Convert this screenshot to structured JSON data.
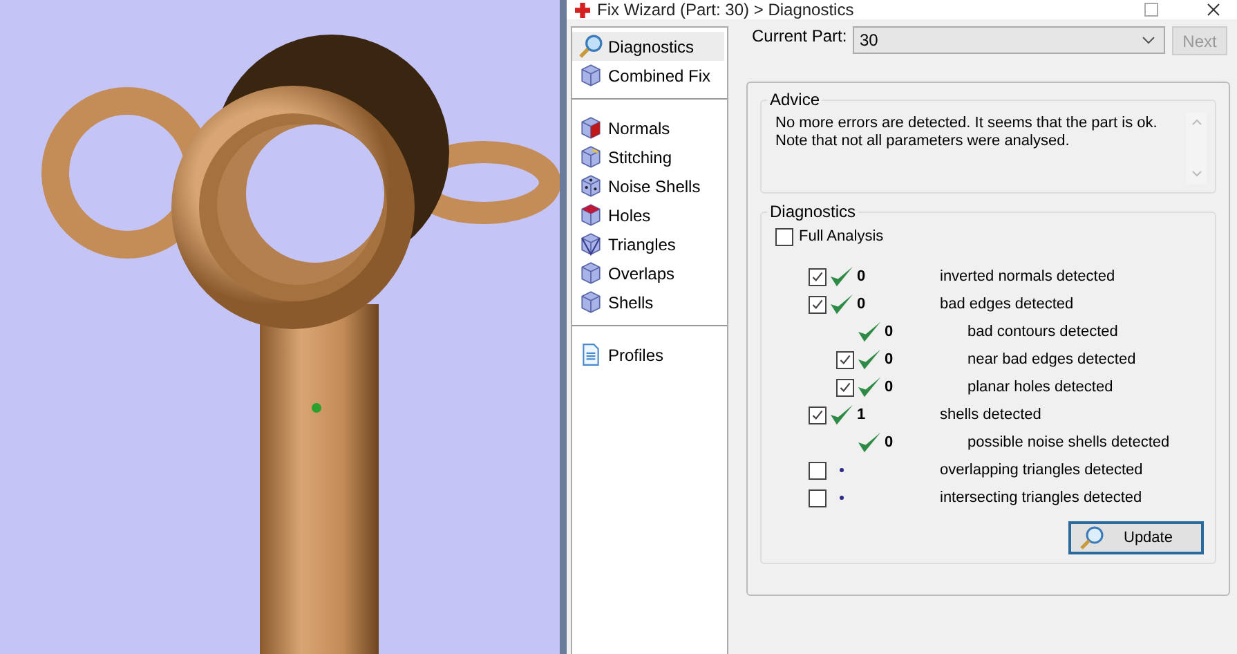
{
  "window": {
    "title": "Fix Wizard (Part: 30) > Diagnostics"
  },
  "sidebar": {
    "groups": [
      {
        "items": [
          {
            "label": "Diagnostics",
            "selected": true
          },
          {
            "label": "Combined Fix",
            "selected": false
          }
        ]
      },
      {
        "items": [
          {
            "label": "Normals",
            "selected": false
          },
          {
            "label": "Stitching",
            "selected": false
          },
          {
            "label": "Noise Shells",
            "selected": false
          },
          {
            "label": "Holes",
            "selected": false
          },
          {
            "label": "Triangles",
            "selected": false
          },
          {
            "label": "Overlaps",
            "selected": false
          },
          {
            "label": "Shells",
            "selected": false
          }
        ]
      },
      {
        "items": [
          {
            "label": "Profiles",
            "selected": false
          }
        ]
      }
    ]
  },
  "current_part": {
    "label": "Current Part:",
    "value": "30"
  },
  "next_button": {
    "label": "Next",
    "disabled": true
  },
  "advice": {
    "title": "Advice",
    "text": "No more errors are detected. It seems that the part is ok.\nNote that not all parameters were analysed."
  },
  "diagnostics": {
    "title": "Diagnostics",
    "full_analysis": {
      "label": "Full Analysis",
      "checked": false
    },
    "rows": [
      {
        "checked": true,
        "kind": "check",
        "count": "0",
        "label": "inverted normals detected"
      },
      {
        "checked": true,
        "kind": "check",
        "count": "0",
        "label": "bad edges detected",
        "children": [
          {
            "kind": "check",
            "count": "0",
            "label": "bad contours detected"
          },
          {
            "checked": true,
            "kind": "check",
            "count": "0",
            "label": "near bad edges detected"
          },
          {
            "checked": true,
            "kind": "check",
            "count": "0",
            "label": "planar holes detected"
          }
        ]
      },
      {
        "checked": true,
        "kind": "check",
        "count": "1",
        "label": "shells detected",
        "children": [
          {
            "kind": "check",
            "count": "0",
            "label": "possible noise shells detected"
          }
        ]
      },
      {
        "checked": false,
        "kind": "dot",
        "label": "overlapping triangles detected"
      },
      {
        "checked": false,
        "kind": "dot",
        "label": "intersecting triangles detected"
      }
    ]
  },
  "update_button": {
    "label": "Update"
  }
}
